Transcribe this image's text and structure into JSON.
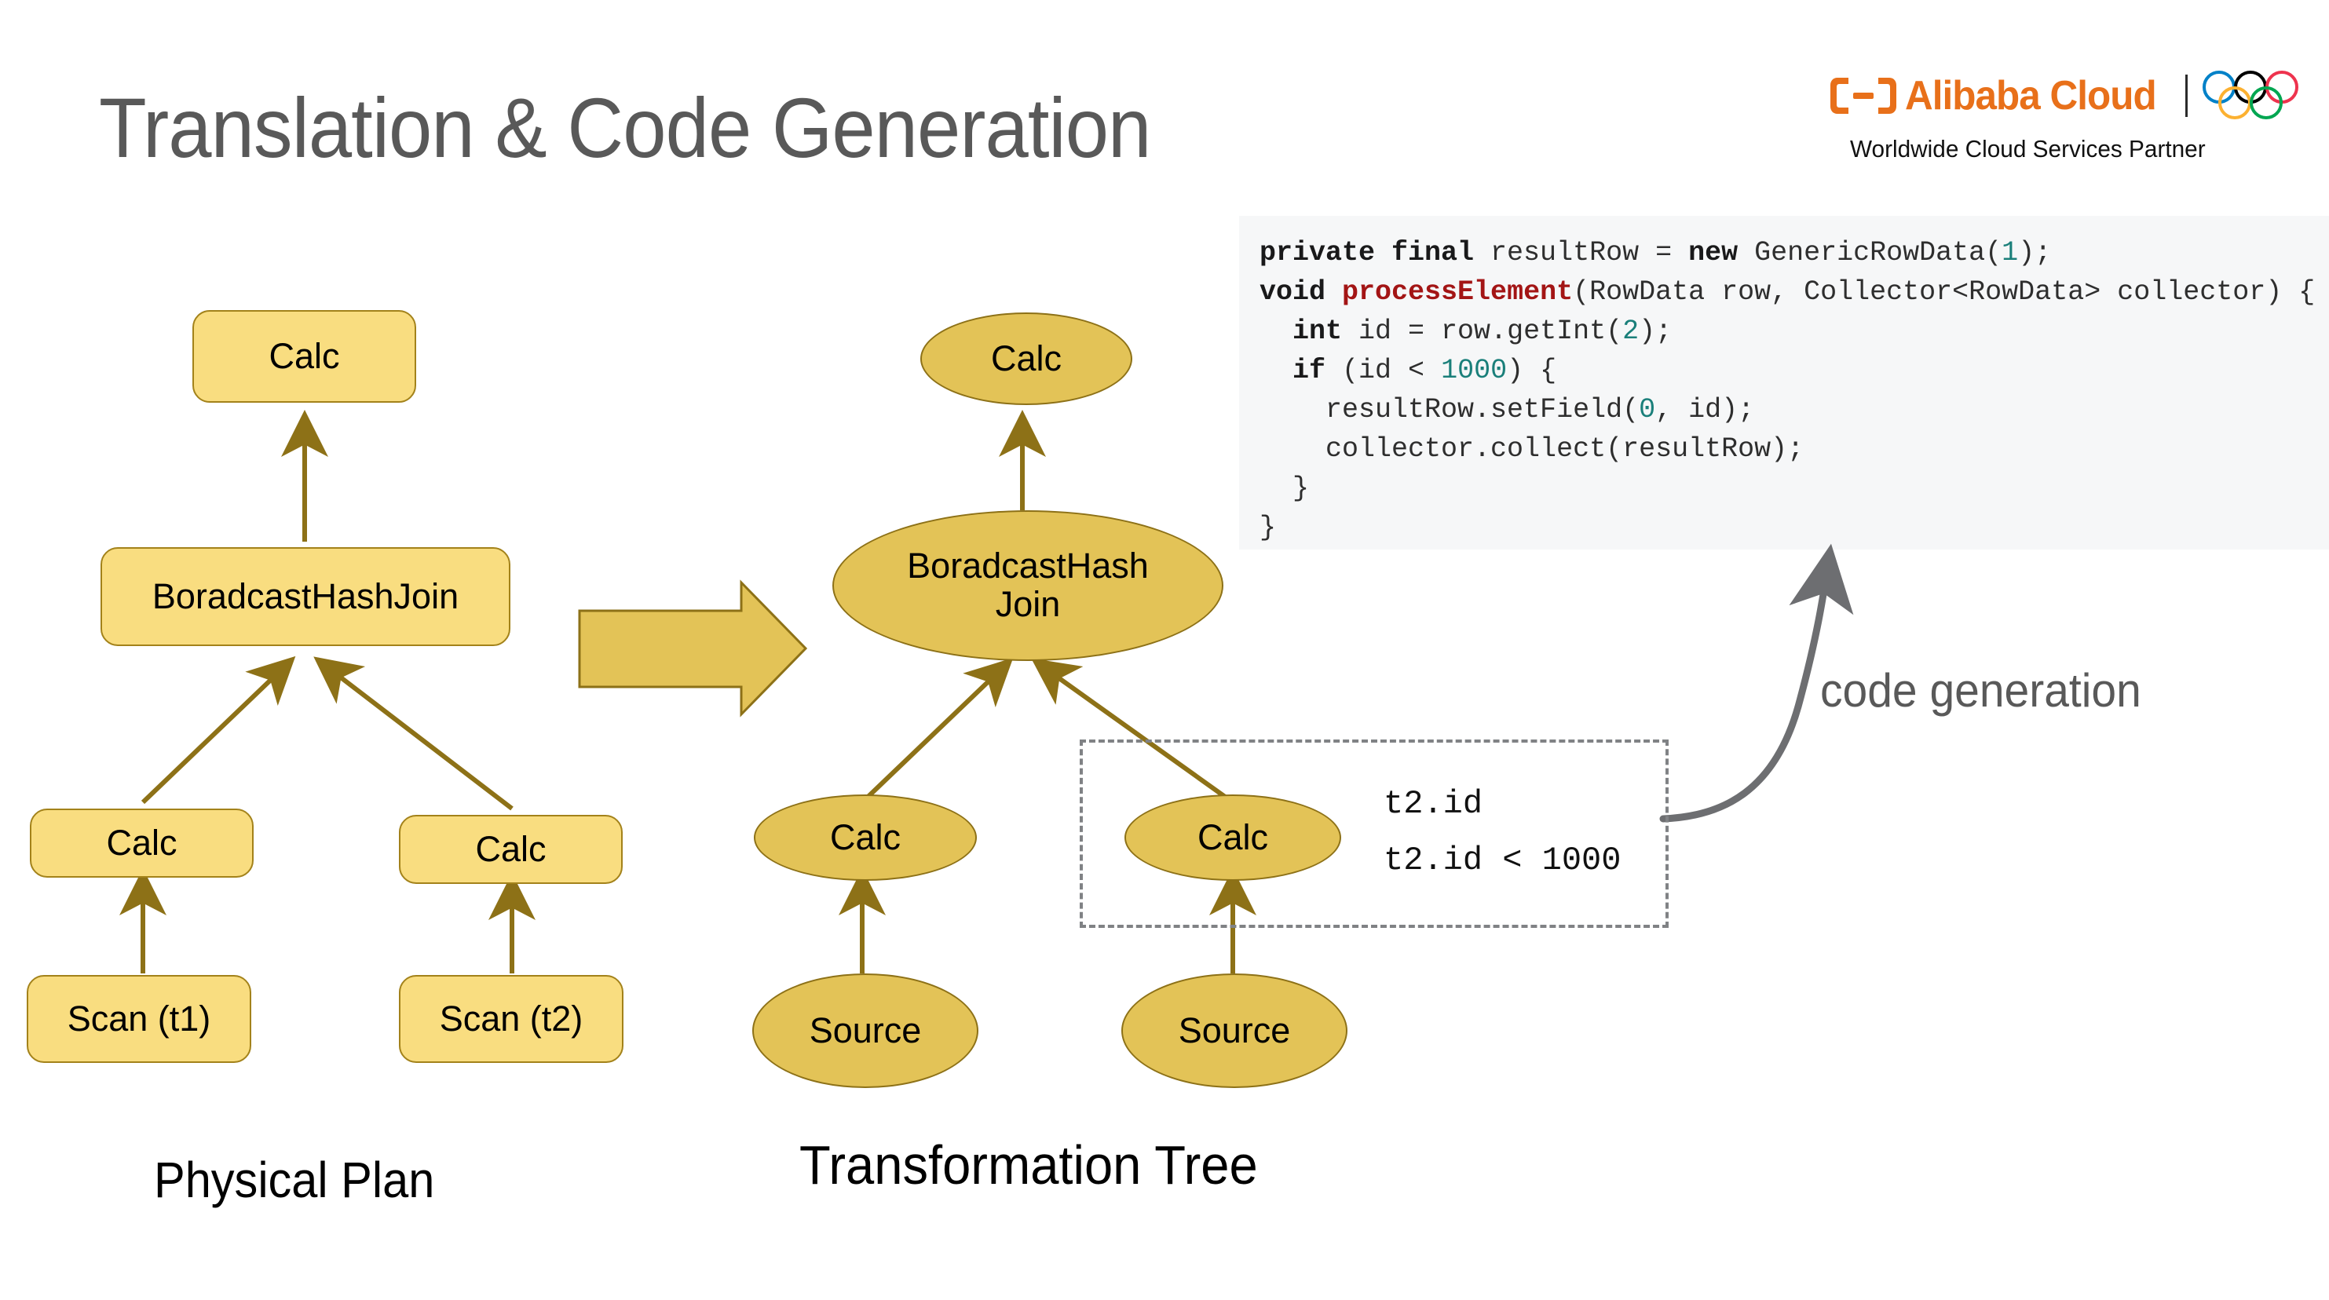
{
  "slide": {
    "title": "Translation & Code Generation"
  },
  "logo": {
    "mark_icon": "alibaba-cloud-mark-icon",
    "wordmark": "Alibaba Cloud",
    "rings_icon": "olympic-rings-icon",
    "tagline": "Worldwide Cloud Services Partner",
    "brand_color": "#e8701a",
    "ring_colors": [
      "#0081c8",
      "#000000",
      "#ee334e",
      "#fcb131",
      "#00a651"
    ]
  },
  "code_block": {
    "background": "#f6f7f8",
    "lines": [
      {
        "indent": 0,
        "tokens": [
          {
            "t": "private final",
            "c": "kw"
          },
          {
            "t": " resultRow = ",
            "c": ""
          },
          {
            "t": "new",
            "c": "kw"
          },
          {
            "t": " GenericRowData(",
            "c": ""
          },
          {
            "t": "1",
            "c": "num"
          },
          {
            "t": ");",
            "c": ""
          }
        ]
      },
      {
        "indent": 0,
        "tokens": [
          {
            "t": "void",
            "c": "kw"
          },
          {
            "t": " ",
            "c": ""
          },
          {
            "t": "processElement",
            "c": "fn"
          },
          {
            "t": "(RowData row, Collector<RowData> collector) {",
            "c": ""
          }
        ]
      },
      {
        "indent": 1,
        "tokens": [
          {
            "t": "int",
            "c": "kw"
          },
          {
            "t": " id = row.getInt(",
            "c": ""
          },
          {
            "t": "2",
            "c": "num"
          },
          {
            "t": ");",
            "c": ""
          }
        ]
      },
      {
        "indent": 1,
        "tokens": [
          {
            "t": "if",
            "c": "kw"
          },
          {
            "t": " (id < ",
            "c": ""
          },
          {
            "t": "1000",
            "c": "num"
          },
          {
            "t": ") {",
            "c": ""
          }
        ]
      },
      {
        "indent": 2,
        "tokens": [
          {
            "t": "resultRow.setField(",
            "c": ""
          },
          {
            "t": "0",
            "c": "num"
          },
          {
            "t": ", id);",
            "c": ""
          }
        ]
      },
      {
        "indent": 2,
        "tokens": [
          {
            "t": "collector.collect(resultRow);",
            "c": ""
          }
        ]
      },
      {
        "indent": 1,
        "tokens": [
          {
            "t": "}",
            "c": ""
          }
        ]
      },
      {
        "indent": 0,
        "tokens": [
          {
            "t": "}",
            "c": ""
          }
        ]
      }
    ]
  },
  "physical_plan": {
    "caption": "Physical Plan",
    "node_fill": "#f9dd80",
    "node_border": "#a3821a",
    "edge_color": "#8d7117",
    "nodes": [
      {
        "id": "pp-calc-root",
        "label": "Calc"
      },
      {
        "id": "pp-broadcast-hash-join",
        "label": "BoradcastHashJoin"
      },
      {
        "id": "pp-calc-left",
        "label": "Calc"
      },
      {
        "id": "pp-calc-right",
        "label": "Calc"
      },
      {
        "id": "pp-scan-t1",
        "label": "Scan (t1)"
      },
      {
        "id": "pp-scan-t2",
        "label": "Scan (t2)"
      }
    ]
  },
  "transform_arrow": {
    "icon": "block-arrow-right-icon",
    "fill": "#e3c357",
    "border": "#8d7117"
  },
  "transformation_tree": {
    "caption": "Transformation Tree",
    "node_fill": "#e3c357",
    "node_border": "#8d7117",
    "edge_color": "#8d7117",
    "nodes": [
      {
        "id": "tt-calc-root",
        "label": "Calc"
      },
      {
        "id": "tt-broadcast-hash-join",
        "label": "BoradcastHash\nJoin"
      },
      {
        "id": "tt-broadcast-hash-join-line1",
        "label": "BoradcastHash"
      },
      {
        "id": "tt-broadcast-hash-join-line2",
        "label": "Join"
      },
      {
        "id": "tt-calc-left",
        "label": "Calc"
      },
      {
        "id": "tt-calc-right",
        "label": "Calc"
      },
      {
        "id": "tt-source-left",
        "label": "Source"
      },
      {
        "id": "tt-source-right",
        "label": "Source"
      }
    ],
    "highlight_box": {
      "style": "dashed",
      "color": "#808285",
      "expressions": [
        "t2.id",
        "t2.id < 1000"
      ]
    }
  },
  "codegen": {
    "label": "code generation",
    "arrow_icon": "curved-arrow-up-icon",
    "color": "#6d6e71"
  }
}
